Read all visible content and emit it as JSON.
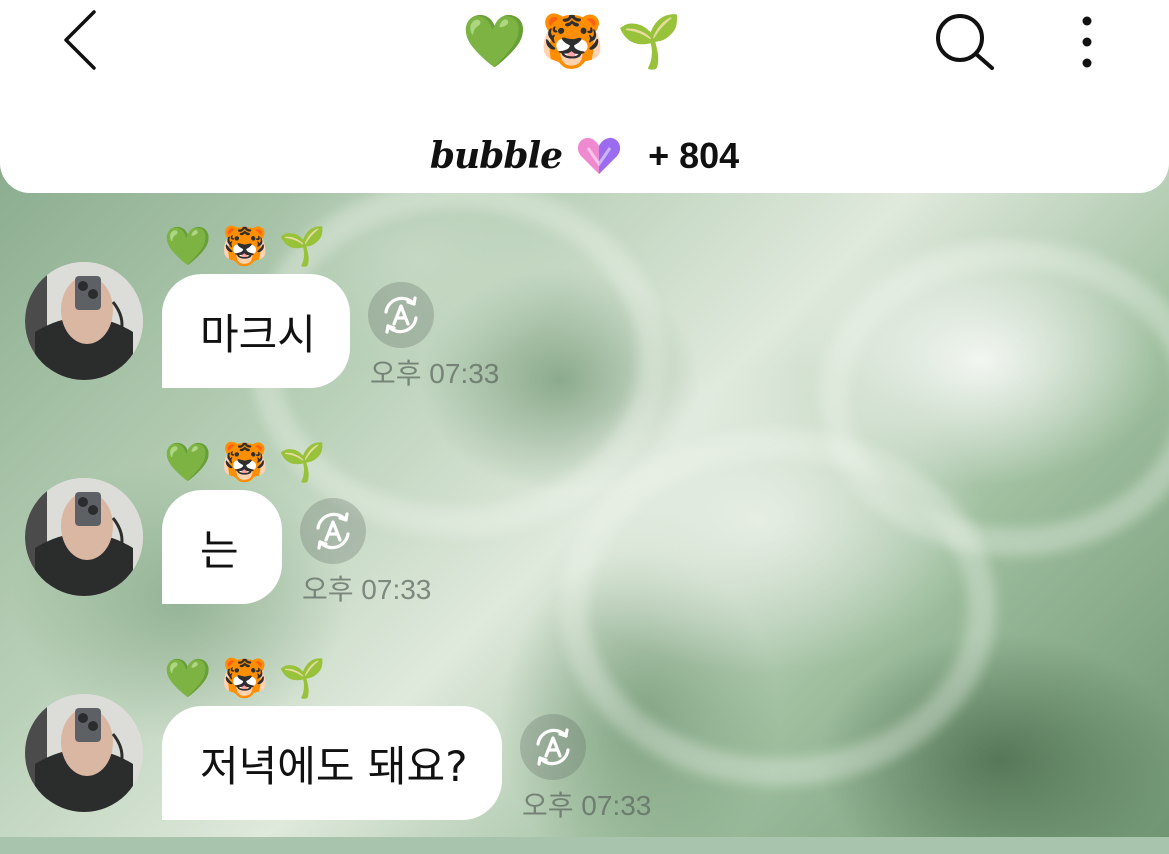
{
  "header": {
    "title_emojis": [
      "💚",
      "🐯",
      "🌱"
    ],
    "brand": "bubble",
    "count": "+ 804"
  },
  "icons": {
    "back": "chevron-left-icon",
    "search": "search-icon",
    "more": "more-vertical-icon",
    "translate": "auto-translate-icon",
    "heart": "bubble-heart-icon"
  },
  "colors": {
    "heart_pink": "#f08ad0",
    "heart_purple": "#9b6cf0",
    "chat_background": "#a9c4ac",
    "bubble": "#ffffff"
  },
  "messages": [
    {
      "sender_emojis": [
        "💚",
        "🐯",
        "🌱"
      ],
      "text": "마크시",
      "time": "오후 07:33"
    },
    {
      "sender_emojis": [
        "💚",
        "🐯",
        "🌱"
      ],
      "text": "는",
      "time": "오후 07:33"
    },
    {
      "sender_emojis": [
        "💚",
        "🐯",
        "🌱"
      ],
      "text": "저녁에도 돼요?",
      "time": "오후 07:33"
    }
  ]
}
